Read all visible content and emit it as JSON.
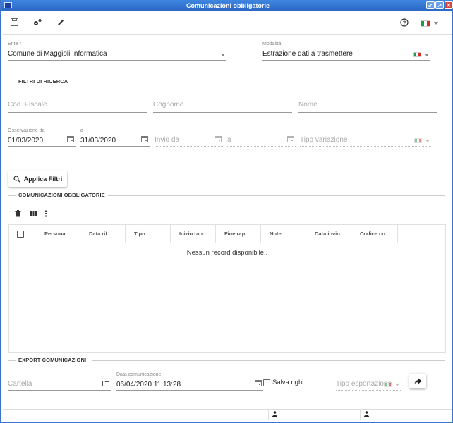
{
  "window": {
    "title": "Comunicazioni obbligatorie",
    "controls": [
      "↙",
      "↗",
      "✕"
    ]
  },
  "toolbar": {
    "icons": [
      "save-icon",
      "settings-icon",
      "edit-icon"
    ],
    "help_icon": "?",
    "language": "it"
  },
  "ente": {
    "label": "Ente *",
    "value": "Comune di Maggioli Informatica"
  },
  "modalita": {
    "label": "Modalità",
    "value": "Estrazione dati a trasmettere"
  },
  "filters": {
    "section_title": "FILTRI DI RICERCA",
    "cod_fiscale": {
      "placeholder": "Cod. Fiscale"
    },
    "cognome": {
      "placeholder": "Cognome"
    },
    "nome": {
      "placeholder": "Nome"
    },
    "osservazione_da": {
      "label": "Osservazione da",
      "value": "01/03/2020"
    },
    "osservazione_a": {
      "label": "a",
      "value": "31/03/2020"
    },
    "invio_da": {
      "placeholder": "Invio da"
    },
    "invio_a": {
      "placeholder": "a"
    },
    "tipo_variazione": {
      "placeholder": "Tipo variazione"
    },
    "apply_label": "Applica Filtri"
  },
  "table": {
    "section_title": "COMUNICAZIONI OBBLIGATORIE",
    "columns": [
      "Persona",
      "Data rif.",
      "Tipo",
      "Inizio rap.",
      "Fine rap.",
      "Note",
      "Data invio",
      "Codice co..."
    ],
    "empty_message": "Nessun record disponibile.."
  },
  "export": {
    "section_title": "EXPORT COMUNICAZIONI",
    "cartella": {
      "placeholder": "Cartella"
    },
    "data_comunicazione": {
      "label": "Data comunicazione",
      "value": "06/04/2020 11:13:28"
    },
    "salva_righi": {
      "label": "Salva righi",
      "checked": false
    },
    "tipo_esportazione": {
      "placeholder": "Tipo esportazione"
    }
  },
  "colors": {
    "titlebar": "#2b66c5",
    "accent": "#3b74c9"
  }
}
